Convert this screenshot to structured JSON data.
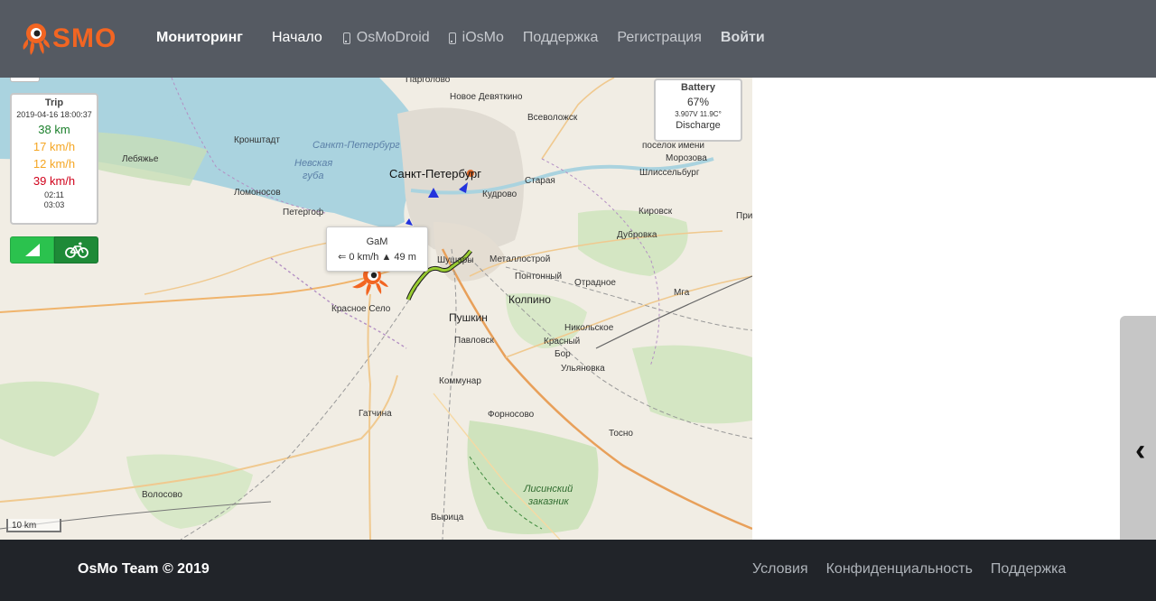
{
  "navbar": {
    "logo_text": "SMO",
    "brand": "Мониторинг",
    "links": [
      {
        "label": "Начало",
        "active": true
      },
      {
        "label": "OsMoDroid",
        "icon": "phone-icon"
      },
      {
        "label": "iOsMo",
        "icon": "phone-icon"
      },
      {
        "label": "Поддержка"
      },
      {
        "label": "Регистрация"
      },
      {
        "label": "Войти"
      }
    ]
  },
  "map": {
    "labels": [
      {
        "text": "Парголово"
      },
      {
        "text": "Новое Девяткино"
      },
      {
        "text": "Всеволожск"
      },
      {
        "text": "Кронштадт"
      },
      {
        "text": "Санкт-Петербург"
      },
      {
        "text": "Лебяжье"
      },
      {
        "text": "Невская"
      },
      {
        "text": "губа"
      },
      {
        "text": "Санкт-Петербург"
      },
      {
        "text": "Старая"
      },
      {
        "text": "Ломоносов"
      },
      {
        "text": "Кудрово"
      },
      {
        "text": "поселок имени"
      },
      {
        "text": "Морозова"
      },
      {
        "text": "Шлиссельбург"
      },
      {
        "text": "Петергоф"
      },
      {
        "text": "Кировск"
      },
      {
        "text": "При"
      },
      {
        "text": "Дубровка"
      },
      {
        "text": "Шушары"
      },
      {
        "text": "Металлострой"
      },
      {
        "text": "Понтонный"
      },
      {
        "text": "Отрадное"
      },
      {
        "text": "Колпино"
      },
      {
        "text": "Мга"
      },
      {
        "text": "Красное Село"
      },
      {
        "text": "Пушкин"
      },
      {
        "text": "Никольское"
      },
      {
        "text": "Павловск"
      },
      {
        "text": "Красный"
      },
      {
        "text": "Бор"
      },
      {
        "text": "Ульяновка"
      },
      {
        "text": "Коммунар"
      },
      {
        "text": "Гатчина"
      },
      {
        "text": "Форносово"
      },
      {
        "text": "Тосно"
      },
      {
        "text": "Лисинский"
      },
      {
        "text": "заказник"
      },
      {
        "text": "Волосово"
      },
      {
        "text": "Вырица"
      }
    ],
    "trip": {
      "title": "Trip",
      "date": "2019-04-16 18:00:37",
      "distance": "38 km",
      "speed_avg": "17 km/h",
      "speed_mov": "12 km/h",
      "speed_max": "39 km/h",
      "time_moving": "02:11",
      "time_total": "03:03"
    },
    "battery": {
      "title": "Battery",
      "percent": "67%",
      "voltage": "3.907V 11.9C°",
      "state": "Discharge"
    },
    "popup": {
      "name": "GaM",
      "info": "⇐ 0 km/h ▲ 49 m"
    },
    "scale": "10 km",
    "colors": {
      "track": "#9acd32",
      "speed_avg": "#f5a623",
      "speed_max": "#d0021b",
      "distance": "#1a7f2a"
    }
  },
  "footer": {
    "copyright": "OsMo Team © 2019",
    "links": [
      "Условия",
      "Конфиденциальность",
      "Поддержка"
    ]
  }
}
